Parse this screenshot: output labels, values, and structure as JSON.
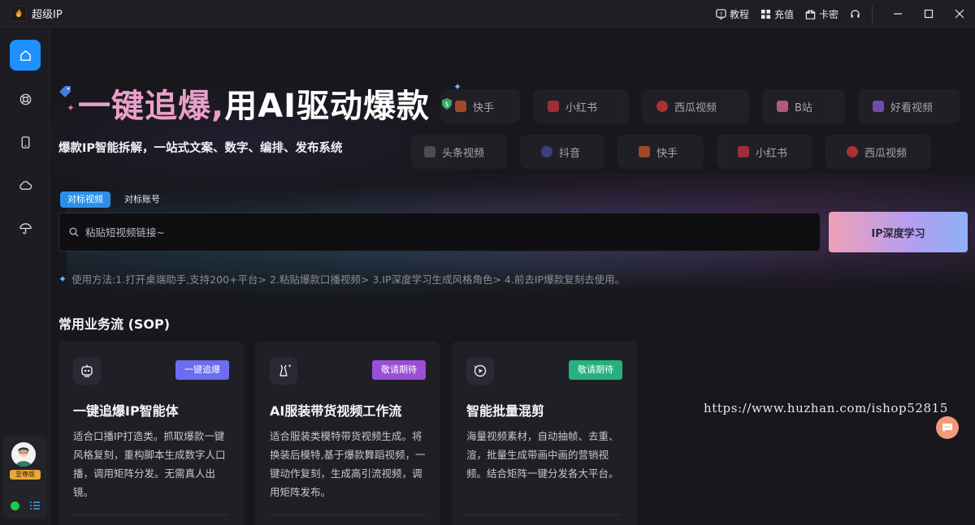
{
  "app": {
    "title": "超级IP"
  },
  "titlebar": {
    "tutorial": "教程",
    "recharge": "充值",
    "card_code": "卡密"
  },
  "sidebar": {
    "items": [
      {
        "icon": "home-icon"
      },
      {
        "icon": "lifebuoy-icon"
      },
      {
        "icon": "phone-icon"
      },
      {
        "icon": "cloud-icon"
      },
      {
        "icon": "umbrella-icon"
      }
    ],
    "user": {
      "vip_label": "至尊版"
    }
  },
  "hero": {
    "title_part1": "一键追爆,",
    "title_part2": "用AI驱动爆款",
    "subtitle": "爆款IP智能拆解，一站式文案、数字、编排、发布系统"
  },
  "platforms_row1": [
    "快手",
    "小红书",
    "西瓜视频",
    "B站",
    "好看视频"
  ],
  "platforms_row2": [
    "头条视频",
    "抖音",
    "快手",
    "小红书",
    "西瓜视频"
  ],
  "search": {
    "tabs": [
      "对标视频",
      "对标账号"
    ],
    "placeholder": "粘贴短视频链接~",
    "button": "IP深度学习"
  },
  "usage_text": "使用方法:1.打开桌端助手,支持200+平台> 2.粘贴爆款口播视频> 3.IP深度学习生成风格角色> 4.前去IP爆款复刻去使用。",
  "sop": {
    "title": "常用业务流 (SOP)",
    "cards": [
      {
        "badge": "一键追爆",
        "badge_color": "#6c6cf0",
        "title": "一键追爆IP智能体",
        "desc": "适合口播IP打造类。抓取爆款一键风格复刻，重构脚本生成数字人口播，调用矩阵分发。无需真人出镜。"
      },
      {
        "badge": "敬请期待",
        "badge_color": "#9a4fd6",
        "title": "AI服装带货视频工作流",
        "desc": "适合服装类模特带货视频生成。将换装后模特,基于爆款舞蹈视频，一键动作复刻，生成高引流视频，调用矩阵发布。"
      },
      {
        "badge": "敬请期待",
        "badge_color": "#25b07e",
        "title": "智能批量混剪",
        "desc": "海量视频素材，自动抽帧、去重、渲，批量生成带画中画的营销视频。结合矩阵一键分发各大平台。"
      }
    ]
  },
  "watermark": "https://www.huzhan.com/ishop52815"
}
